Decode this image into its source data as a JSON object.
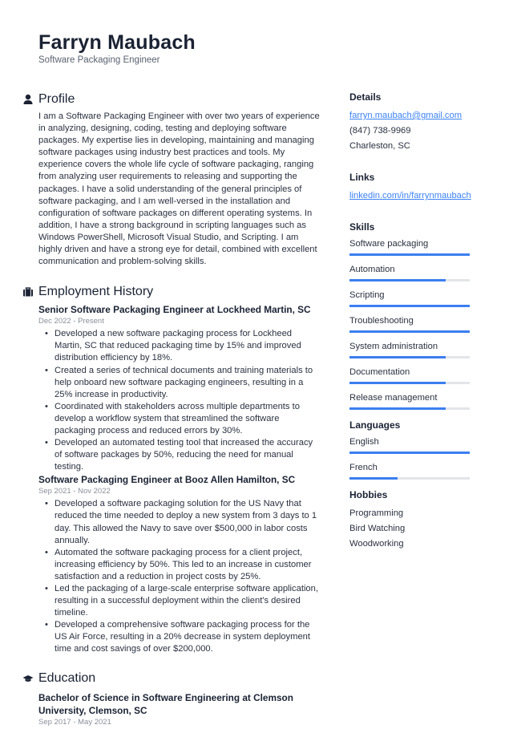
{
  "header": {
    "name": "Farryn Maubach",
    "title": "Software Packaging Engineer"
  },
  "profile": {
    "heading": "Profile",
    "icon": "person-icon",
    "text": "I am a Software Packaging Engineer with over two years of experience in analyzing, designing, coding, testing and deploying software packages. My expertise lies in developing, maintaining and managing software packages using industry best practices and tools. My experience covers the whole life cycle of software packaging, ranging from analyzing user requirements to releasing and supporting the packages. I have a solid understanding of the general principles of software packaging, and I am well-versed in the installation and configuration of software packages on different operating systems. In addition, I have a strong background in scripting languages such as Windows PowerShell, Microsoft Visual Studio, and Scripting. I am highly driven and have a strong eye for detail, combined with excellent communication and problem-solving skills."
  },
  "employment": {
    "heading": "Employment History",
    "icon": "briefcase-icon",
    "jobs": [
      {
        "title": "Senior Software Packaging Engineer at Lockheed Martin, SC",
        "dates": "Dec 2022 - Present",
        "bullets": [
          "Developed a new software packaging process for Lockheed Martin, SC that reduced packaging time by 15% and improved distribution efficiency by 18%.",
          "Created a series of technical documents and training materials to help onboard new software packaging engineers, resulting in a 25% increase in productivity.",
          "Coordinated with stakeholders across multiple departments to develop a workflow system that streamlined the software packaging process and reduced errors by 30%.",
          "Developed an automated testing tool that increased the accuracy of software packages by 50%, reducing the need for manual testing."
        ]
      },
      {
        "title": "Software Packaging Engineer at Booz Allen Hamilton, SC",
        "dates": "Sep 2021 - Nov 2022",
        "bullets": [
          "Developed a software packaging solution for the US Navy that reduced the time needed to deploy a new system from 3 days to 1 day. This allowed the Navy to save over $500,000 in labor costs annually.",
          "Automated the software packaging process for a client project, increasing efficiency by 50%. This led to an increase in customer satisfaction and a reduction in project costs by 25%.",
          "Led the packaging of a large-scale enterprise software application, resulting in a successful deployment within the client's desired timeline.",
          "Developed a comprehensive software packaging process for the US Air Force, resulting in a 20% decrease in system deployment time and cost savings of over $200,000."
        ]
      }
    ]
  },
  "education": {
    "heading": "Education",
    "icon": "graduation-cap-icon",
    "items": [
      {
        "title": "Bachelor of Science in Software Engineering at Clemson University, Clemson, SC",
        "dates": "Sep 2017 - May 2021"
      }
    ]
  },
  "sidebar": {
    "details": {
      "heading": "Details",
      "email": "farryn.maubach@gmail.com",
      "phone": "(847) 738-9969",
      "location": "Charleston, SC"
    },
    "links": {
      "heading": "Links",
      "items": [
        "linkedin.com/in/farrynmaubach"
      ]
    },
    "skills": {
      "heading": "Skills",
      "items": [
        {
          "label": "Software packaging",
          "level": 1.0
        },
        {
          "label": "Automation",
          "level": 0.8
        },
        {
          "label": "Scripting",
          "level": 1.0
        },
        {
          "label": "Troubleshooting",
          "level": 1.0
        },
        {
          "label": "System administration",
          "level": 0.8
        },
        {
          "label": "Documentation",
          "level": 0.8
        },
        {
          "label": "Release management",
          "level": 0.8
        }
      ]
    },
    "languages": {
      "heading": "Languages",
      "items": [
        {
          "label": "English",
          "level": 1.0
        },
        {
          "label": "French",
          "level": 0.4
        }
      ]
    },
    "hobbies": {
      "heading": "Hobbies",
      "items": [
        "Programming",
        "Bird Watching",
        "Woodworking"
      ]
    }
  },
  "colors": {
    "accent": "#3b7ff0",
    "link": "#3b82f6",
    "text": "#1a2233",
    "muted": "#8a909a",
    "track": "#e3e5e8"
  }
}
